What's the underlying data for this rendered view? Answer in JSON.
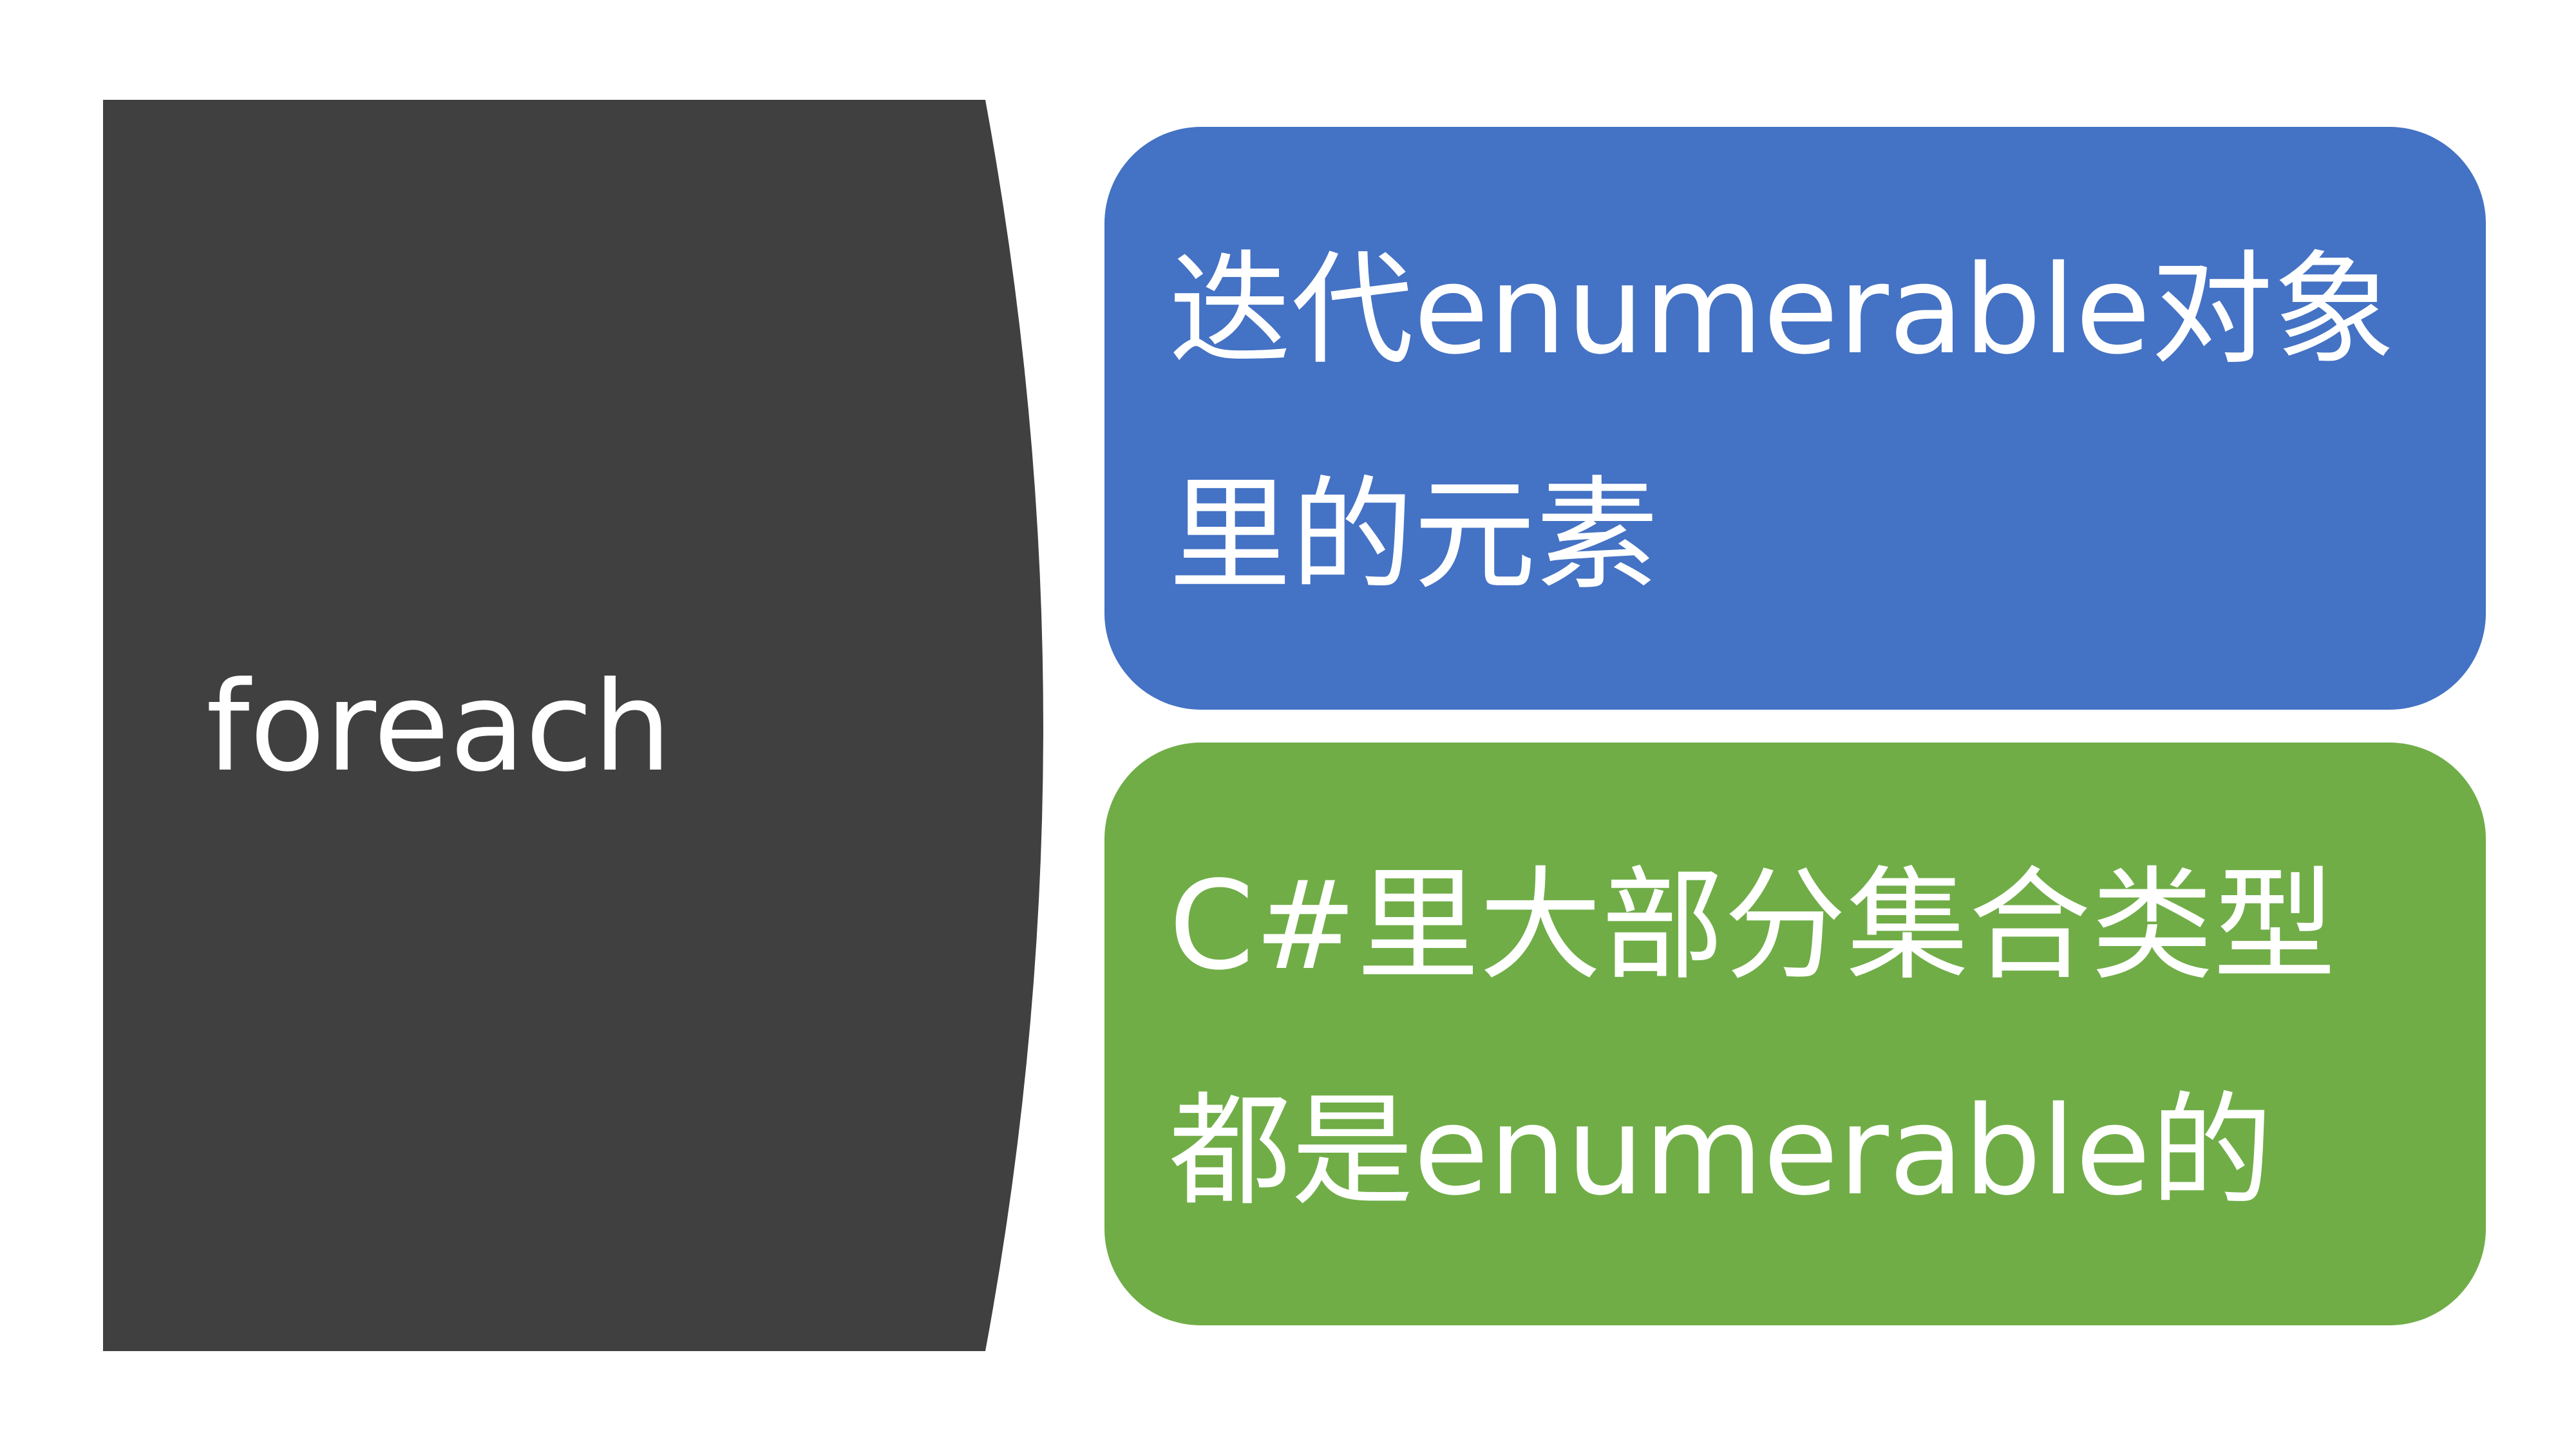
{
  "left_panel": {
    "label": "foreach",
    "color": "#404040"
  },
  "boxes": [
    {
      "text": "迭代enumerable对象里的元素",
      "color": "#4472c4"
    },
    {
      "text": "C#里大部分集合类型都是enumerable的",
      "color": "#70ad47"
    }
  ]
}
